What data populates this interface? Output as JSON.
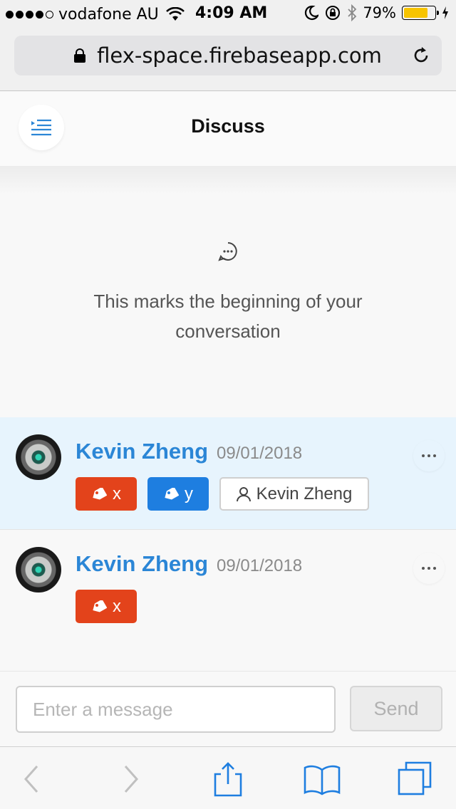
{
  "status_bar": {
    "carrier": "vodafone AU",
    "time": "4:09 AM",
    "battery_percent": "79%",
    "battery_level": 0.79
  },
  "browser": {
    "url": "flex-space.firebaseapp.com"
  },
  "header": {
    "title": "Discuss"
  },
  "conversation": {
    "beginning_text": "This marks the beginning of your conversation"
  },
  "messages": [
    {
      "author": "Kevin Zheng",
      "date": "09/01/2018",
      "tags": [
        {
          "label": "x",
          "color": "#e3431b"
        },
        {
          "label": "y",
          "color": "#1e7ee0"
        }
      ],
      "user_tag": "Kevin Zheng"
    },
    {
      "author": "Kevin Zheng",
      "date": "09/01/2018",
      "tags": [
        {
          "label": "x",
          "color": "#e3431b"
        }
      ]
    }
  ],
  "composer": {
    "placeholder": "Enter a message",
    "send_label": "Send"
  },
  "colors": {
    "accent": "#2b86d6",
    "tag_red": "#e3431b",
    "tag_blue": "#1e7ee0",
    "highlight": "#e7f4fd"
  }
}
